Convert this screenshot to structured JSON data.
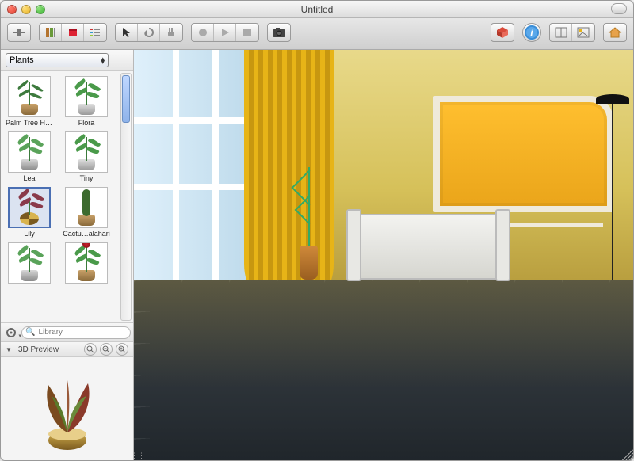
{
  "window": {
    "title": "Untitled"
  },
  "toolbar": {
    "left": [
      {
        "name": "sidebar-toggle-icon",
        "glyph": "sidebar"
      },
      {
        "name": "library-books-icon",
        "glyph": "books"
      },
      {
        "name": "library-red-icon",
        "glyph": "redbox"
      },
      {
        "name": "list-view-icon",
        "glyph": "list"
      }
    ],
    "tools": [
      {
        "name": "pointer-tool-icon",
        "glyph": "pointer"
      },
      {
        "name": "rotate-tool-icon",
        "glyph": "rotate"
      },
      {
        "name": "pan-tool-icon",
        "glyph": "pan"
      }
    ],
    "record": [
      {
        "name": "record-icon",
        "glyph": "record"
      },
      {
        "name": "play-icon",
        "glyph": "play"
      },
      {
        "name": "stop-icon",
        "glyph": "stop"
      }
    ],
    "camera": {
      "name": "camera-icon",
      "glyph": "camera"
    },
    "right": [
      {
        "name": "package-icon",
        "glyph": "package"
      },
      {
        "name": "info-icon",
        "glyph": "info"
      },
      {
        "name": "view-split-icon",
        "glyph": "split"
      },
      {
        "name": "view-picture-icon",
        "glyph": "picture"
      },
      {
        "name": "home-icon",
        "glyph": "home"
      }
    ]
  },
  "sidebar": {
    "category": "Plants",
    "items": [
      {
        "label": "Palm Tree High",
        "style": "palm",
        "selected": false
      },
      {
        "label": "Flora",
        "style": "flora",
        "selected": false
      },
      {
        "label": "Lea",
        "style": "spider",
        "selected": false
      },
      {
        "label": "Tiny",
        "style": "flora",
        "selected": false
      },
      {
        "label": "Lily",
        "style": "lily",
        "selected": true
      },
      {
        "label": "Cactu…alahari",
        "style": "cactus",
        "selected": false
      },
      {
        "label": "",
        "style": "spider",
        "selected": false
      },
      {
        "label": "",
        "style": "rose",
        "selected": false
      }
    ],
    "searchPlaceholder": "Library",
    "preview": {
      "title": "3D Preview"
    }
  }
}
